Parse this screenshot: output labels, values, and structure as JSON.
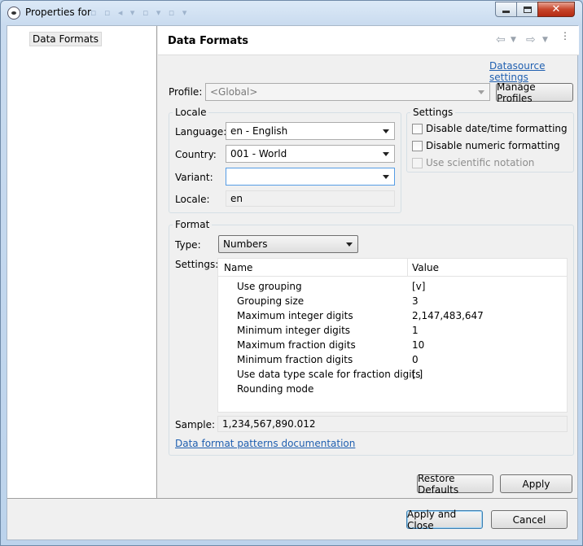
{
  "window": {
    "title": "Properties for",
    "icon": "app-icon",
    "controls": {
      "minimize": "minimize-icon",
      "maximize": "maximize-icon",
      "close": "close-icon"
    }
  },
  "tree": {
    "items": [
      {
        "label": "Data Formats"
      }
    ]
  },
  "page": {
    "title": "Data Formats",
    "datasource_link": "Datasource settings",
    "nav_icons": [
      "back-arrow-icon",
      "dropdown-icon",
      "forward-arrow-icon",
      "dropdown-icon",
      "view-menu-icon"
    ]
  },
  "profile": {
    "label": "Profile:",
    "value": "<Global>",
    "manage_button": "Manage Profiles"
  },
  "locale": {
    "group_title": "Locale",
    "language_label": "Language:",
    "language_value": "en - English",
    "country_label": "Country:",
    "country_value": "001 - World",
    "variant_label": "Variant:",
    "variant_value": "",
    "locale_label": "Locale:",
    "locale_value": "en"
  },
  "settings": {
    "group_title": "Settings",
    "options": [
      {
        "label": "Disable date/time formatting",
        "checked": false,
        "enabled": true
      },
      {
        "label": "Disable numeric formatting",
        "checked": false,
        "enabled": true
      },
      {
        "label": "Use scientific notation",
        "checked": false,
        "enabled": false
      }
    ]
  },
  "format": {
    "group_title": "Format",
    "type_label": "Type:",
    "type_value": "Numbers",
    "settings_label": "Settings:",
    "columns": [
      "Name",
      "Value"
    ],
    "rows": [
      {
        "name": "Use grouping",
        "value": "[v]"
      },
      {
        "name": "Grouping size",
        "value": "3"
      },
      {
        "name": "Maximum integer digits",
        "value": "2,147,483,647"
      },
      {
        "name": "Minimum integer digits",
        "value": "1"
      },
      {
        "name": "Maximum fraction digits",
        "value": "10"
      },
      {
        "name": "Minimum fraction digits",
        "value": "0"
      },
      {
        "name": "Use data type scale for fraction digits",
        "value": "[  ]"
      },
      {
        "name": "Rounding mode",
        "value": ""
      }
    ],
    "sample_label": "Sample:",
    "sample_value": "1,234,567,890.012",
    "docs_link": "Data format patterns documentation"
  },
  "buttons": {
    "restore_defaults": "Restore Defaults",
    "apply": "Apply",
    "apply_and_close": "Apply and Close",
    "cancel": "Cancel"
  }
}
